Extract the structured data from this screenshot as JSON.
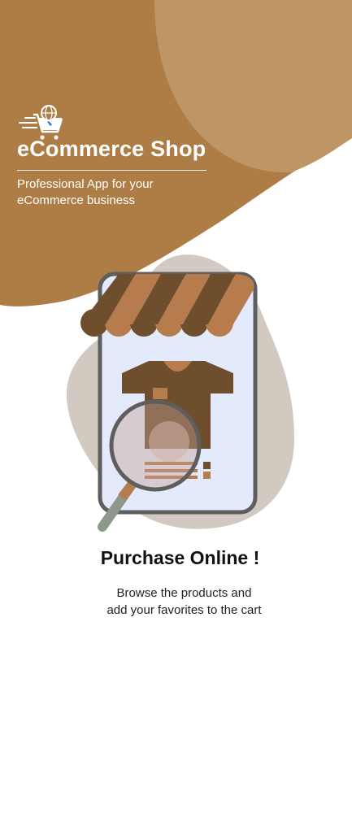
{
  "app": {
    "title": "eCommerce Shop",
    "subtitle_line1": "Professional App for your",
    "subtitle_line2": "eCommerce business",
    "logo_icon": "shopping-cart-globe-icon"
  },
  "onboarding": {
    "title": "Purchase Online !",
    "description_line1": "Browse the products and",
    "description_line2": "add your favorites to the cart",
    "illustration": "storefront-phone-search-illustration"
  },
  "colors": {
    "brand_primary": "#AE7D45",
    "brand_light": "#BE9665",
    "awning_dark": "#6F4E2E",
    "awning_light": "#B77C4E",
    "blob": "#D2CAC1",
    "phone_frame": "#5E5E5E",
    "phone_screen": "#E3EAFB",
    "magnifier_handle": "#8E978C"
  }
}
